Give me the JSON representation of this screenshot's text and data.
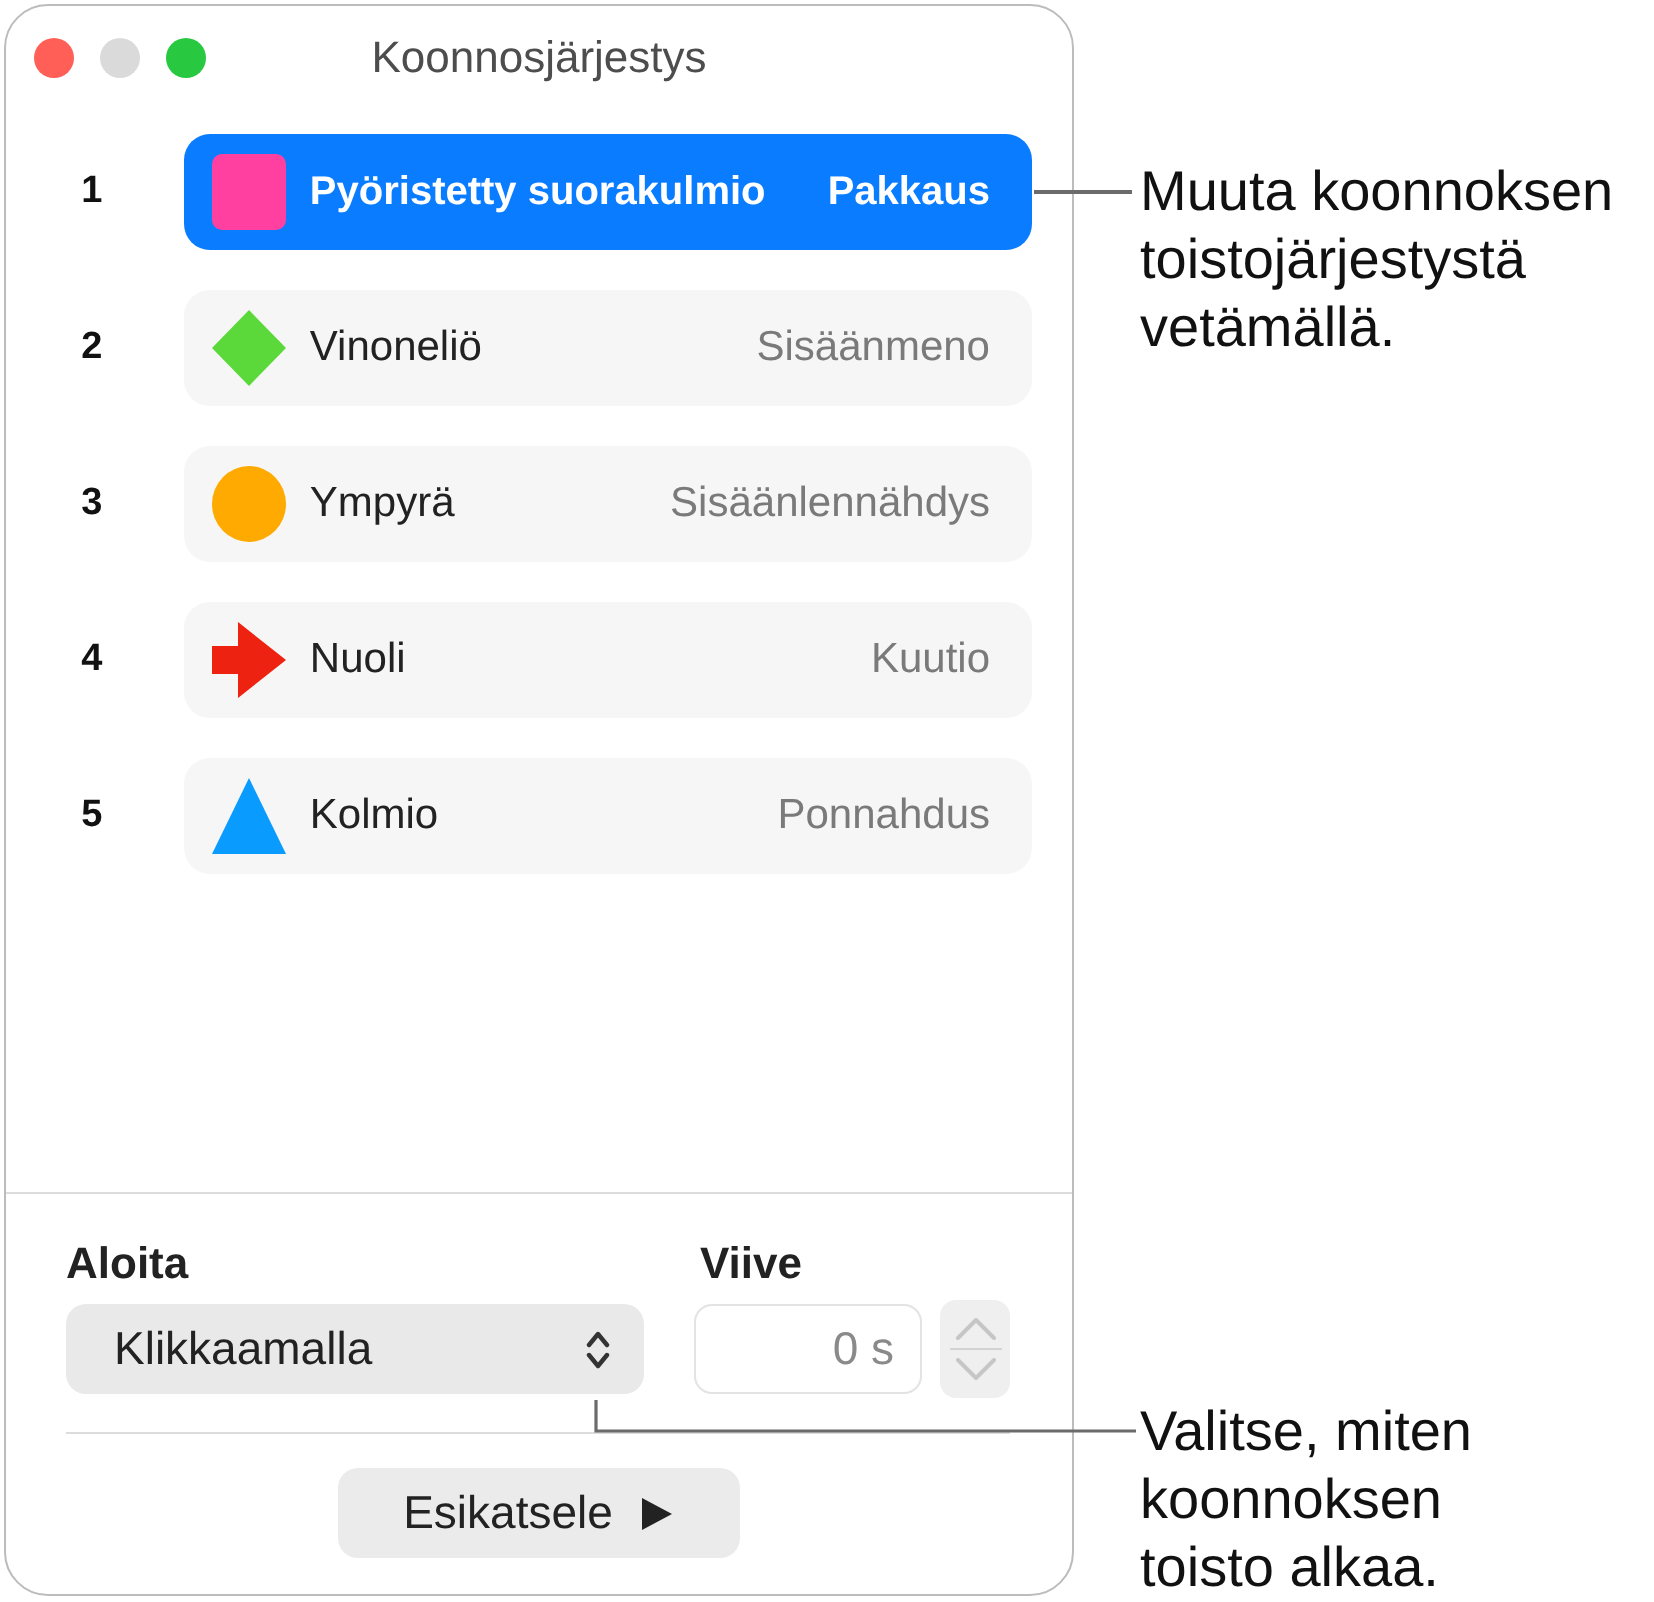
{
  "window": {
    "title": "Koonnosjärjestys",
    "minimize_disabled": true
  },
  "builds": [
    {
      "number": "1",
      "kind": "rounded-rectangle",
      "color": "#ff40a0",
      "name": "Pyöristetty suorakulmio",
      "effect": "Pakkaus",
      "selected": true
    },
    {
      "number": "2",
      "kind": "diamond",
      "color": "#5cd93a",
      "name": "Vinoneliö",
      "effect": "Sisäänmeno",
      "selected": false
    },
    {
      "number": "3",
      "kind": "circle",
      "color": "#ffaa00",
      "name": "Ympyrä",
      "effect": "Sisäänlennähdys",
      "selected": false
    },
    {
      "number": "4",
      "kind": "arrow",
      "color": "#ee2211",
      "name": "Nuoli",
      "effect": "Kuutio",
      "selected": false
    },
    {
      "number": "5",
      "kind": "triangle",
      "color": "#0a9bff",
      "name": "Kolmio",
      "effect": "Ponnahdus",
      "selected": false
    }
  ],
  "start": {
    "label": "Aloita",
    "value": "Klikkaamalla"
  },
  "delay": {
    "label": "Viive",
    "value": "0 s"
  },
  "preview_button": {
    "label": "Esikatsele"
  },
  "callouts": [
    {
      "text": "Muuta koonnoksen toistojärjestystä vetämällä."
    },
    {
      "text": "Valitse, miten koonnoksen toisto alkaa."
    }
  ]
}
